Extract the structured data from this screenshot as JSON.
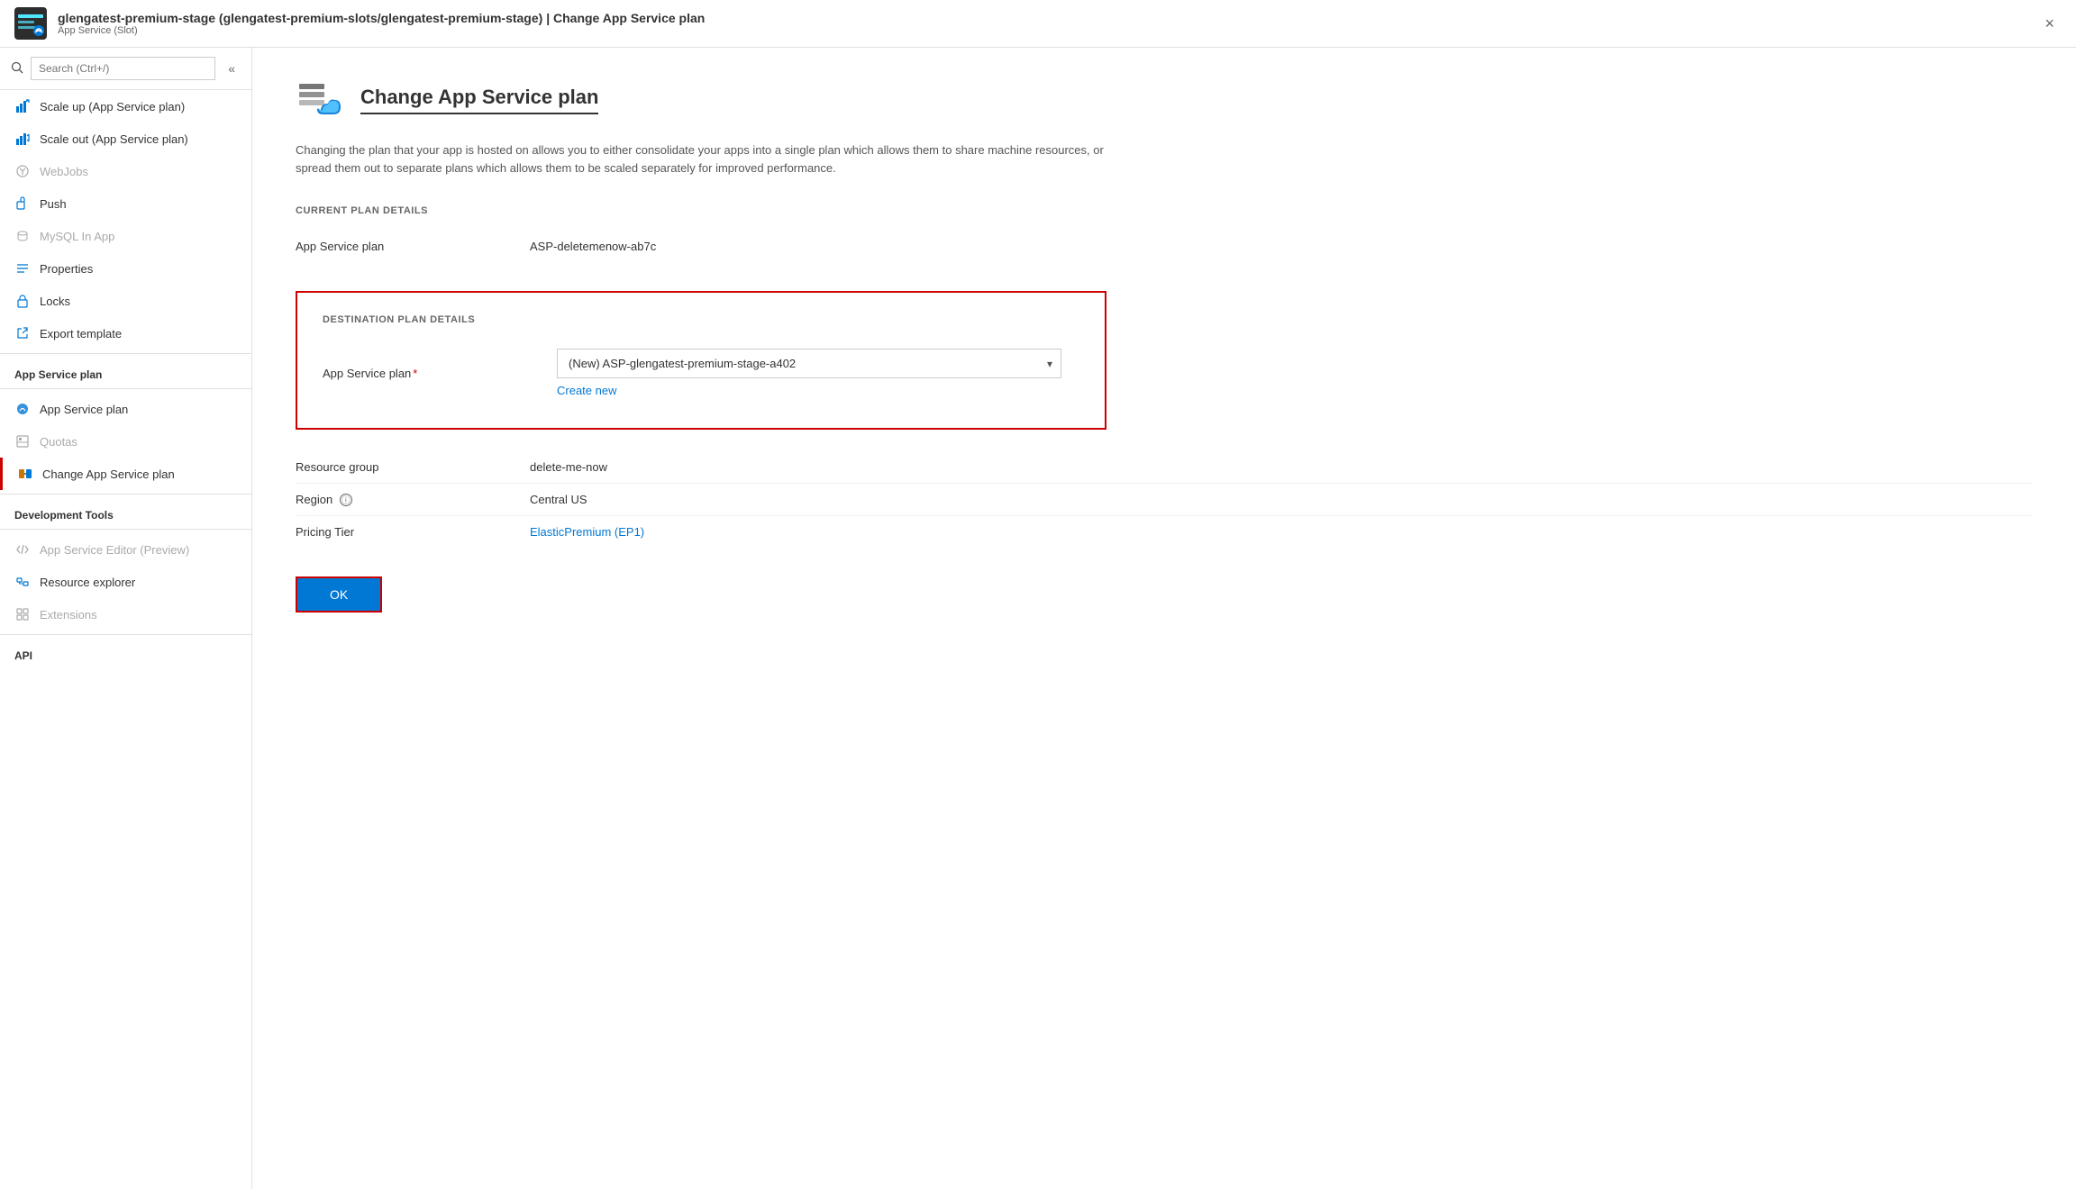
{
  "titleBar": {
    "title": "glengatest-premium-stage (glengatest-premium-slots/glengatest-premium-stage) | Change App Service plan",
    "subtitle": "App Service (Slot)",
    "closeLabel": "×"
  },
  "sidebar": {
    "searchPlaceholder": "Search (Ctrl+/)",
    "collapseLabel": "«",
    "items": [
      {
        "id": "scale-up",
        "label": "Scale up (App Service plan)",
        "icon": "scale-up",
        "disabled": false
      },
      {
        "id": "scale-out",
        "label": "Scale out (App Service plan)",
        "icon": "scale-out",
        "disabled": false
      },
      {
        "id": "webjobs",
        "label": "WebJobs",
        "icon": "webjobs",
        "disabled": true
      },
      {
        "id": "push",
        "label": "Push",
        "icon": "push",
        "disabled": false
      },
      {
        "id": "mysql-in-app",
        "label": "MySQL In App",
        "icon": "mysql",
        "disabled": true
      },
      {
        "id": "properties",
        "label": "Properties",
        "icon": "properties",
        "disabled": false
      },
      {
        "id": "locks",
        "label": "Locks",
        "icon": "locks",
        "disabled": false
      },
      {
        "id": "export-template",
        "label": "Export template",
        "icon": "export",
        "disabled": false
      }
    ],
    "sectionAppServicePlan": "App Service plan",
    "appServicePlanItems": [
      {
        "id": "app-service-plan",
        "label": "App Service plan",
        "icon": "plan",
        "disabled": false
      },
      {
        "id": "quotas",
        "label": "Quotas",
        "icon": "quotas",
        "disabled": true
      },
      {
        "id": "change-app-service-plan",
        "label": "Change App Service plan",
        "icon": "change-plan",
        "active": true
      }
    ],
    "sectionDevTools": "Development Tools",
    "devToolsItems": [
      {
        "id": "app-service-editor",
        "label": "App Service Editor (Preview)",
        "icon": "editor",
        "disabled": true
      },
      {
        "id": "resource-explorer",
        "label": "Resource explorer",
        "icon": "explorer",
        "disabled": false
      },
      {
        "id": "extensions",
        "label": "Extensions",
        "icon": "extensions",
        "disabled": true
      }
    ],
    "sectionApi": "API"
  },
  "content": {
    "pageTitle": "Change App Service plan",
    "description": "Changing the plan that your app is hosted on allows you to either consolidate your apps into a single plan which allows them to share machine resources, or spread them out to separate plans which allows them to be scaled separately for improved performance.",
    "currentPlanSection": "CURRENT PLAN DETAILS",
    "currentPlanLabel": "App Service plan",
    "currentPlanValue": "ASP-deletemenow-ab7c",
    "destinationSection": "DESTINATION PLAN DETAILS",
    "destinationPlanLabel": "App Service plan",
    "destinationPlanDropdownValue": "(New) ASP-glengatest-premium-stage-a402",
    "createNewLabel": "Create new",
    "resourceGroupLabel": "Resource group",
    "resourceGroupValue": "delete-me-now",
    "regionLabel": "Region",
    "regionValue": "Central US",
    "pricingTierLabel": "Pricing Tier",
    "pricingTierValue": "ElasticPremium (EP1)",
    "okLabel": "OK"
  }
}
